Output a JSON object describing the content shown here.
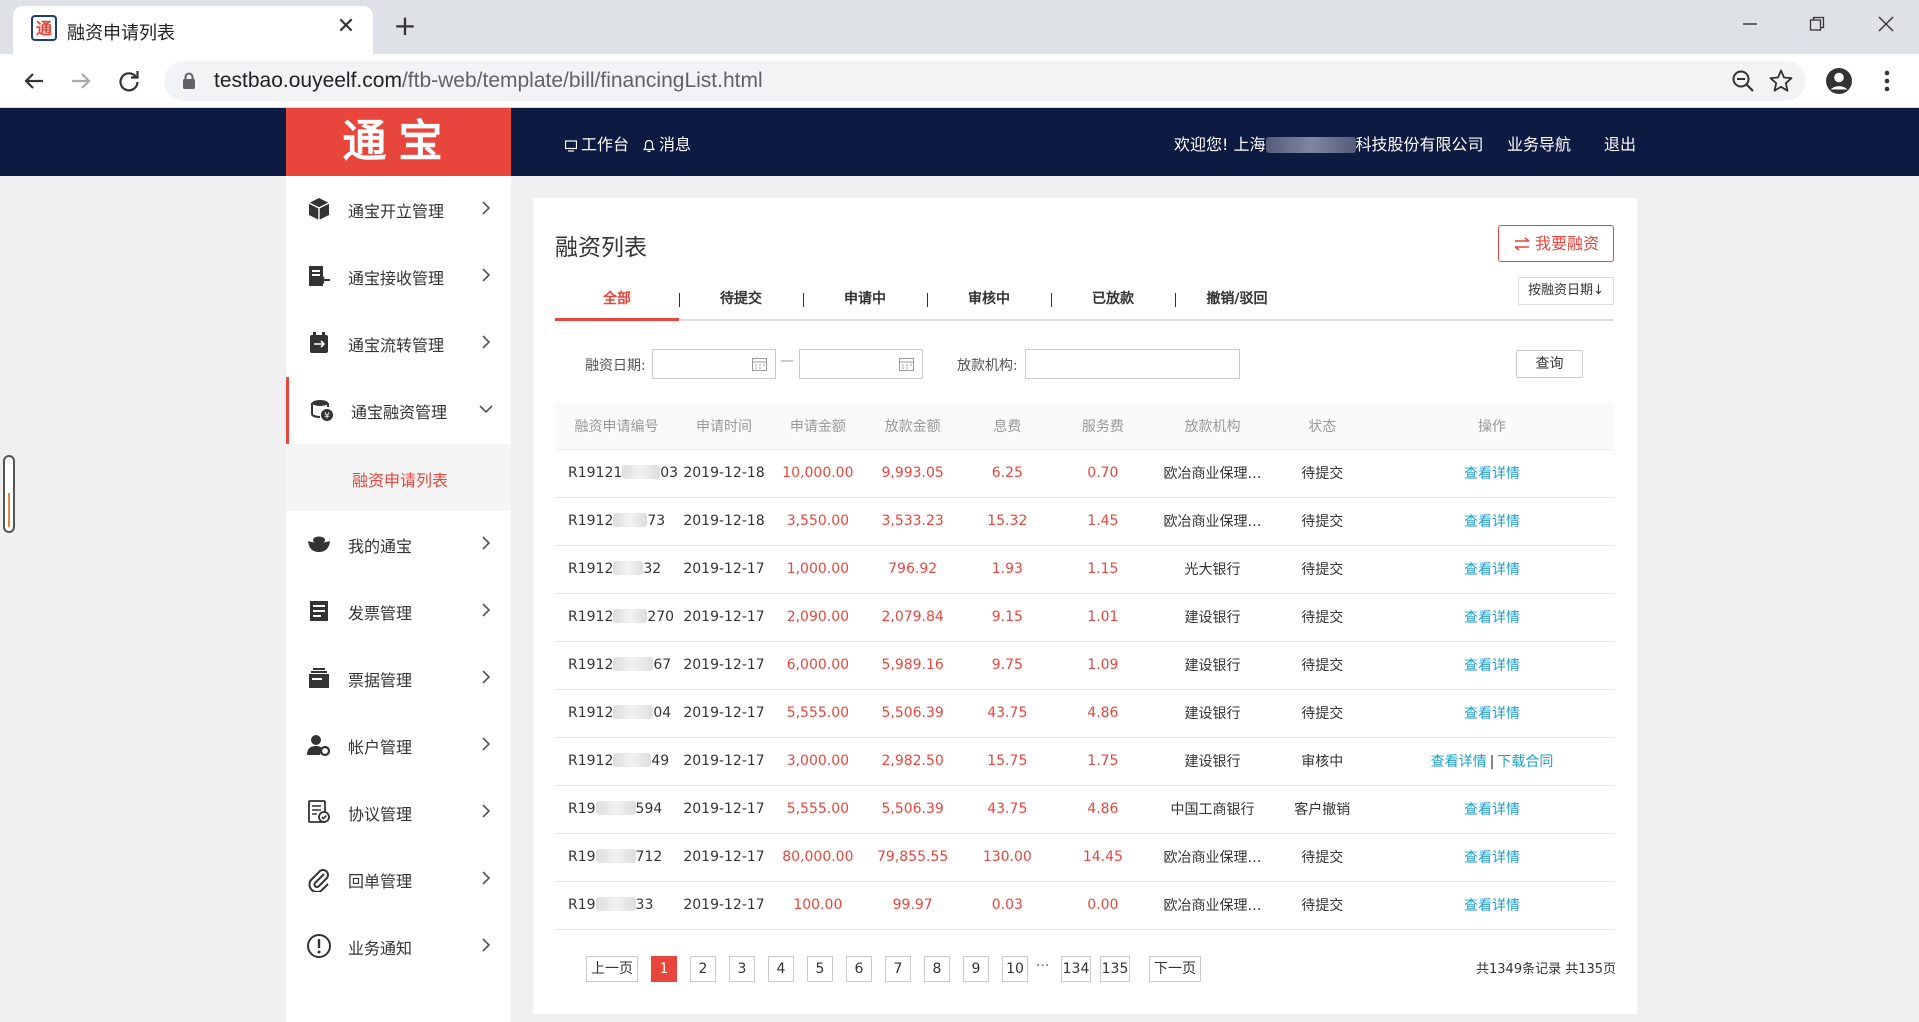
{
  "browser": {
    "tab_title": "融资申请列表",
    "url_host": "testbao.ouyeelf.com",
    "url_path": "/ftb-web/template/bill/financingList.html"
  },
  "header": {
    "logo": "通宝",
    "workbench": "工作台",
    "messages": "消息",
    "welcome_prefix": "欢迎您! 上海",
    "welcome_suffix": "科技股份有限公司",
    "biz_nav": "业务导航",
    "logout": "退出"
  },
  "sidebar": {
    "items": [
      {
        "label": "通宝开立管理",
        "icon": "cube-icon"
      },
      {
        "label": "通宝接收管理",
        "icon": "receive-icon"
      },
      {
        "label": "通宝流转管理",
        "icon": "transfer-icon"
      },
      {
        "label": "通宝融资管理",
        "icon": "coins-icon"
      },
      {
        "label": "我的通宝",
        "icon": "ingot-icon"
      },
      {
        "label": "发票管理",
        "icon": "invoice-icon"
      },
      {
        "label": "票据管理",
        "icon": "bills-icon"
      },
      {
        "label": "帐户管理",
        "icon": "user-gear-icon"
      },
      {
        "label": "协议管理",
        "icon": "contract-icon"
      },
      {
        "label": "回单管理",
        "icon": "paperclip-icon"
      },
      {
        "label": "业务通知",
        "icon": "alert-icon"
      }
    ],
    "sub_item": "融资申请列表"
  },
  "main": {
    "title": "融资列表",
    "apply_button": "我要融资",
    "sort_button": "按融资日期↓",
    "tabs": [
      "全部",
      "待提交",
      "申请中",
      "审核中",
      "已放款",
      "撤销/驳回"
    ],
    "filters": {
      "date_label": "融资日期:",
      "date_sep": "—",
      "org_label": "放款机构:",
      "query_button": "查询"
    },
    "columns": [
      "融资申请编号",
      "申请时间",
      "申请金额",
      "放款金额",
      "息费",
      "服务费",
      "放款机构",
      "状态",
      "操作"
    ],
    "rows": [
      {
        "id_prefix": "R19121",
        "id_suffix": "03",
        "date": "2019-12-18",
        "apply": "10,000.00",
        "loan": "9,993.05",
        "interest": "6.25",
        "fee": "0.70",
        "org": "欧冶商业保理…",
        "status": "待提交",
        "ops": [
          "查看详情"
        ]
      },
      {
        "id_prefix": "R1912",
        "id_suffix": "73",
        "date": "2019-12-18",
        "apply": "3,550.00",
        "loan": "3,533.23",
        "interest": "15.32",
        "fee": "1.45",
        "org": "欧冶商业保理…",
        "status": "待提交",
        "ops": [
          "查看详情"
        ]
      },
      {
        "id_prefix": "R1912",
        "id_suffix": "32",
        "date": "2019-12-17",
        "apply": "1,000.00",
        "loan": "796.92",
        "interest": "1.93",
        "fee": "1.15",
        "org": "光大银行",
        "status": "待提交",
        "ops": [
          "查看详情"
        ]
      },
      {
        "id_prefix": "R1912",
        "id_suffix": "270",
        "date": "2019-12-17",
        "apply": "2,090.00",
        "loan": "2,079.84",
        "interest": "9.15",
        "fee": "1.01",
        "org": "建设银行",
        "status": "待提交",
        "ops": [
          "查看详情"
        ]
      },
      {
        "id_prefix": "R1912",
        "id_suffix": "67",
        "date": "2019-12-17",
        "apply": "6,000.00",
        "loan": "5,989.16",
        "interest": "9.75",
        "fee": "1.09",
        "org": "建设银行",
        "status": "待提交",
        "ops": [
          "查看详情"
        ]
      },
      {
        "id_prefix": "R1912",
        "id_suffix": "04",
        "date": "2019-12-17",
        "apply": "5,555.00",
        "loan": "5,506.39",
        "interest": "43.75",
        "fee": "4.86",
        "org": "建设银行",
        "status": "待提交",
        "ops": [
          "查看详情"
        ]
      },
      {
        "id_prefix": "R1912",
        "id_suffix": "49",
        "date": "2019-12-17",
        "apply": "3,000.00",
        "loan": "2,982.50",
        "interest": "15.75",
        "fee": "1.75",
        "org": "建设银行",
        "status": "审核中",
        "ops": [
          "查看详情",
          "下载合同"
        ]
      },
      {
        "id_prefix": "R19",
        "id_suffix": "594",
        "date": "2019-12-17",
        "apply": "5,555.00",
        "loan": "5,506.39",
        "interest": "43.75",
        "fee": "4.86",
        "org": "中国工商银行",
        "status": "客户撤销",
        "ops": [
          "查看详情"
        ]
      },
      {
        "id_prefix": "R19",
        "id_suffix": "712",
        "date": "2019-12-17",
        "apply": "80,000.00",
        "loan": "79,855.55",
        "interest": "130.00",
        "fee": "14.45",
        "org": "欧冶商业保理…",
        "status": "待提交",
        "ops": [
          "查看详情"
        ]
      },
      {
        "id_prefix": "R19",
        "id_suffix": "33",
        "date": "2019-12-17",
        "apply": "100.00",
        "loan": "99.97",
        "interest": "0.03",
        "fee": "0.00",
        "org": "欧冶商业保理…",
        "status": "待提交",
        "ops": [
          "查看详情"
        ]
      }
    ],
    "pager": {
      "prev": "上一页",
      "pages": [
        "1",
        "2",
        "3",
        "4",
        "5",
        "6",
        "7",
        "8",
        "9",
        "10"
      ],
      "ellipsis": "···",
      "last_pages": [
        "134",
        "135"
      ],
      "next": "下一页",
      "current": "1",
      "total": "共1349条记录 共135页"
    }
  },
  "colors": {
    "brand_red": "#e8453c",
    "header_navy": "#0d1a42",
    "link_blue": "#1e9ecf"
  }
}
